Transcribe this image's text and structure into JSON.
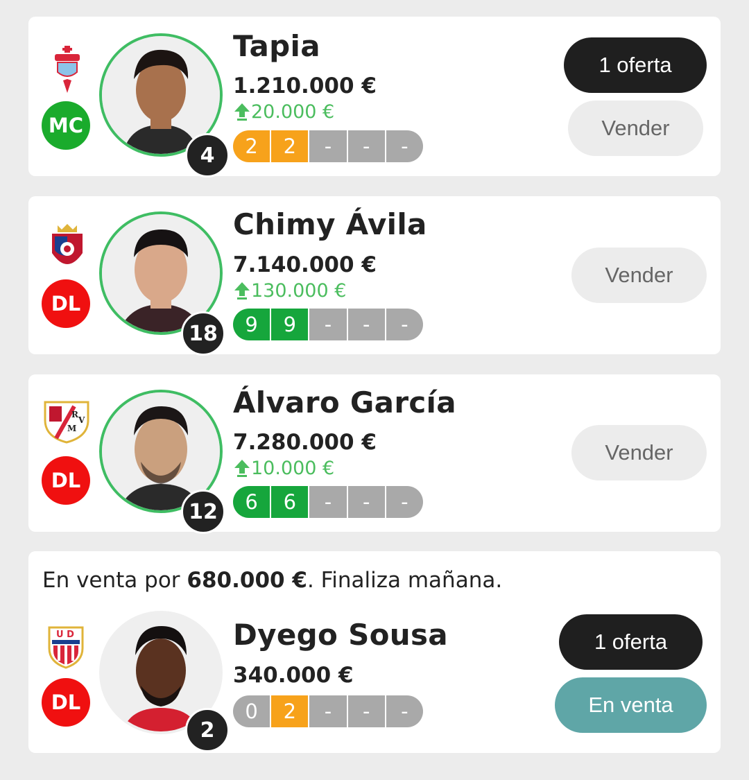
{
  "colors": {
    "mc_badge": "#1aab2c",
    "dl_badge": "#f01010",
    "avatar_ring": "#3fbd63",
    "delta_green": "#4bbd5e",
    "score_orange": "#f7a21b",
    "score_green": "#16a63c",
    "score_empty": "#a9a9a9",
    "dark_button": "#1f1f1f",
    "teal_button": "#5fa6a7"
  },
  "players": [
    {
      "team_icon": "celta-vigo-crest-icon",
      "position": "MC",
      "name": "Tapia",
      "jersey": "4",
      "price": "1.210.000 €",
      "delta": "20.000 €",
      "scores": [
        "2",
        "2",
        "-",
        "-",
        "-"
      ],
      "offer_label": "1 oferta",
      "sell_label": "Vender"
    },
    {
      "team_icon": "osasuna-crest-icon",
      "position": "DL",
      "name": "Chimy Ávila",
      "jersey": "18",
      "price": "7.140.000 €",
      "delta": "130.000 €",
      "scores": [
        "9",
        "9",
        "-",
        "-",
        "-"
      ],
      "sell_label": "Vender"
    },
    {
      "team_icon": "rayo-vallecano-crest-icon",
      "position": "DL",
      "name": "Álvaro García",
      "jersey": "12",
      "price": "7.280.000 €",
      "delta": "10.000 €",
      "scores": [
        "6",
        "6",
        "-",
        "-",
        "-"
      ],
      "sell_label": "Vender"
    },
    {
      "team_icon": "almeria-crest-icon",
      "position": "DL",
      "name": "Dyego Sousa",
      "jersey": "2",
      "price": "340.000 €",
      "scores": [
        "0",
        "2",
        "-",
        "-",
        "-"
      ],
      "offer_label": "1 oferta",
      "on_sale_label": "En venta",
      "sale_note": {
        "prefix": "En venta por ",
        "amount": "680.000 €",
        "suffix": ". Finaliza mañana."
      }
    }
  ]
}
